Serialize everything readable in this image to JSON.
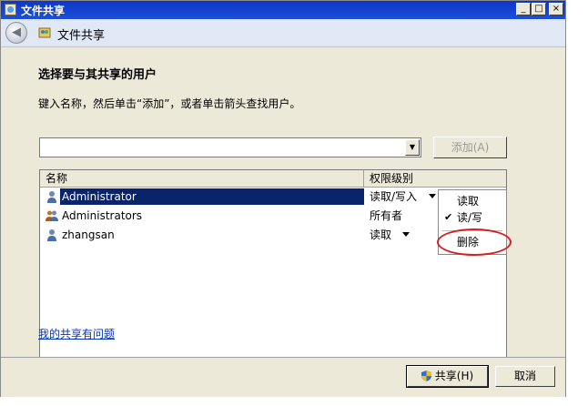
{
  "window": {
    "title": "文件共享"
  },
  "titlebar_buttons": {
    "minimize": "_",
    "maximize": "□",
    "close": "×"
  },
  "nav": {
    "title": "文件共享",
    "back_icon": "back-arrow-icon",
    "back_glyph": "◀"
  },
  "content": {
    "heading": "选择要与其共享的用户",
    "instruction": "键入名称，然后单击“添加”，或者单击箭头查找用户。"
  },
  "user_input": {
    "value": "",
    "arrow_glyph": "▼"
  },
  "add_button": {
    "label": "添加(A)"
  },
  "list": {
    "columns": {
      "name": "名称",
      "permission": "权限级别"
    },
    "rows": [
      {
        "name": "Administrator",
        "permission": "读取/写入",
        "icon": "user-icon",
        "selected": true,
        "has_dropdown": true
      },
      {
        "name": "Administrators",
        "permission": "所有者",
        "icon": "group-icon",
        "selected": false,
        "has_dropdown": false
      },
      {
        "name": "zhangsan",
        "permission": "读取",
        "icon": "user-icon",
        "selected": false,
        "has_dropdown": true
      }
    ]
  },
  "context_menu": {
    "items": [
      {
        "label": "读取",
        "checked": false
      },
      {
        "label": "读/写",
        "checked": true
      },
      {
        "label": "删除",
        "checked": false
      }
    ],
    "check_glyph": "✔"
  },
  "help_link": "我的共享有问题",
  "footer": {
    "share_label": "共享(H)",
    "cancel_label": "取消"
  },
  "colors": {
    "selection": "#0a246a",
    "highlight_circle": "#d42020",
    "link": "#0033cc"
  }
}
